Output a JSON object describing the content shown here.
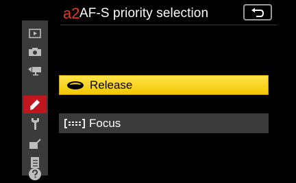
{
  "header": {
    "code": "a2",
    "title": "AF-S priority selection",
    "back_icon": "return-arrow-icon"
  },
  "sidebar": {
    "tabs": [
      {
        "icon": "playback-icon",
        "active": false
      },
      {
        "icon": "camera-icon",
        "active": false
      },
      {
        "icon": "movie-camera-icon",
        "active": false
      },
      {
        "icon": "pencil-icon",
        "active": true
      },
      {
        "icon": "wrench-icon",
        "active": false
      },
      {
        "icon": "retouch-icon",
        "active": false
      },
      {
        "icon": "my-menu-icon",
        "active": false
      },
      {
        "icon": "help-icon",
        "active": false
      }
    ]
  },
  "options": [
    {
      "label": "Release",
      "icon": "release-icon",
      "selected": true
    },
    {
      "label": "Focus",
      "icon": "focus-icon",
      "selected": false
    }
  ],
  "colors": {
    "accent_red": "#c0161e",
    "highlight_yellow": "#f3c600",
    "panel_gray": "#3a3a3a"
  }
}
